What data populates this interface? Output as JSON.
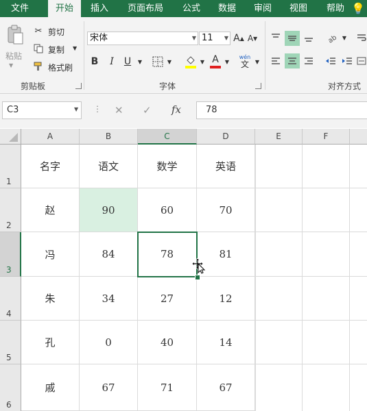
{
  "tabs": [
    "文件",
    "开始",
    "插入",
    "页面布局",
    "公式",
    "数据",
    "审阅",
    "视图",
    "帮助"
  ],
  "active_tab": "开始",
  "clipboard": {
    "paste": "粘贴",
    "cut": "剪切",
    "copy": "复制",
    "format_painter": "格式刷",
    "group_label": "剪贴板"
  },
  "font": {
    "name": "宋体",
    "size": "11",
    "group_label": "字体",
    "bold": "B",
    "italic": "I",
    "underline": "U",
    "grow": "A",
    "shrink": "A",
    "font_color_letter": "A",
    "phonetic": "wén",
    "phonetic_char": "文"
  },
  "alignment": {
    "group_label": "对齐方式"
  },
  "formula_bar": {
    "name_box": "C3",
    "cancel": "✕",
    "enter": "✓",
    "fx": "fx",
    "value": "78"
  },
  "columns": [
    "A",
    "B",
    "C",
    "D",
    "E",
    "F"
  ],
  "selected_column": "C",
  "rows": [
    "1",
    "2",
    "3",
    "4",
    "5",
    "6"
  ],
  "selected_row": "3",
  "active_cell": "C3",
  "table": [
    [
      "名字",
      "语文",
      "数学",
      "英语"
    ],
    [
      "赵",
      "90",
      "60",
      "70"
    ],
    [
      "冯",
      "84",
      "78",
      "81"
    ],
    [
      "朱",
      "34",
      "27",
      "12"
    ],
    [
      "孔",
      "0",
      "40",
      "14"
    ],
    [
      "戚",
      "67",
      "71",
      "67"
    ]
  ],
  "colors": {
    "accent": "#217346",
    "highlight_cell": "#d9f0e1"
  }
}
